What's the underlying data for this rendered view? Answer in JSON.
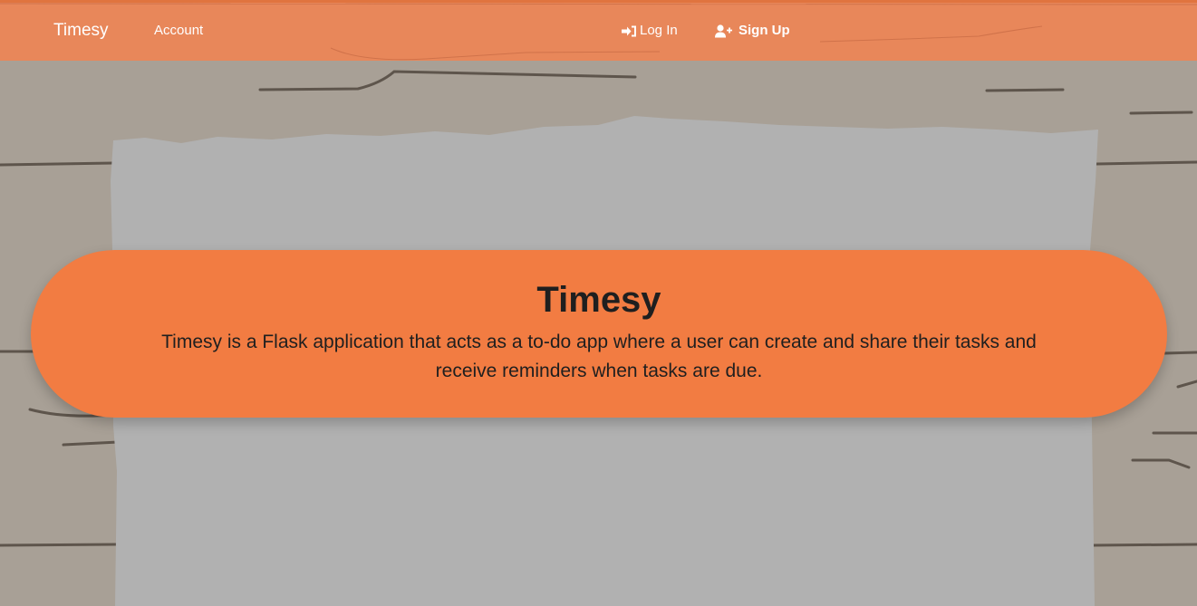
{
  "navbar": {
    "brand": "Timesy",
    "account_label": "Account",
    "login_label": "Log In",
    "signup_label": "Sign Up",
    "login_icon": "sign-in-icon",
    "signup_icon": "user-plus-icon"
  },
  "hero": {
    "title": "Timesy",
    "description": "Timesy is a Flask application that acts as a to-do app where a user can create and share their tasks and receive reminders when tasks are due."
  },
  "colors": {
    "navbar": "#e8875a",
    "hero": "#f27c42",
    "background": "#a8a096",
    "paper": "#b1b1b1",
    "text_dark": "#1f1f1f",
    "nav_text": "#ffffff"
  }
}
